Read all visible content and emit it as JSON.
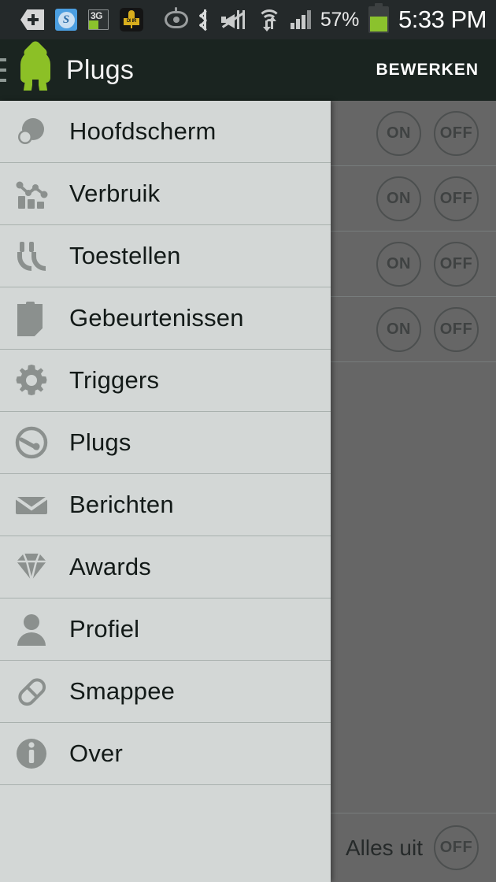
{
  "status_bar": {
    "background": "#24292a",
    "left_icons": [
      {
        "name": "add-tag-icon",
        "label": "add"
      },
      {
        "name": "skype-icon",
        "label": "S"
      },
      {
        "name": "network-3g-icon",
        "label": "3G"
      },
      {
        "name": "dnr-recorder-icon",
        "label": "DNR"
      }
    ],
    "right_icons": [
      {
        "name": "smart-stay-eye-icon",
        "label": "smart-stay"
      },
      {
        "name": "bluetooth-icon",
        "label": "bluetooth"
      },
      {
        "name": "sound-mute-vibrate-icon",
        "label": "mute"
      },
      {
        "name": "wifi-icon",
        "label": "wifi"
      },
      {
        "name": "cellular-signal-icon",
        "label": "signal"
      }
    ],
    "battery_percent": "57%",
    "battery_color": "#8bc22d",
    "time": "5:33 PM"
  },
  "app_bar": {
    "background": "#1a2420",
    "menu_icon": "hamburger-menu-icon",
    "logo_icon": "smappee-logo-icon",
    "logo_color": "#8cc026",
    "title": "Plugs",
    "action_label": "BEWERKEN"
  },
  "drawer": {
    "background": "#d3d7d6",
    "items": [
      {
        "label": "Hoofdscherm",
        "icon": "dashboard-icon"
      },
      {
        "label": "Verbruik",
        "icon": "consumption-chart-icon"
      },
      {
        "label": "Toestellen",
        "icon": "appliances-plug-icon"
      },
      {
        "label": "Gebeurtenissen",
        "icon": "events-clipboard-icon"
      },
      {
        "label": "Triggers",
        "icon": "gear-icon"
      },
      {
        "label": "Plugs",
        "icon": "plugs-circle-icon"
      },
      {
        "label": "Berichten",
        "icon": "envelope-icon"
      },
      {
        "label": "Awards",
        "icon": "diamond-icon"
      },
      {
        "label": "Profiel",
        "icon": "person-icon"
      },
      {
        "label": "Smappee",
        "icon": "smappee-pill-icon"
      },
      {
        "label": "Over",
        "icon": "info-icon"
      }
    ]
  },
  "content": {
    "overlay_color": "#666666",
    "plug_rows": [
      {
        "on_label": "ON",
        "off_label": "OFF"
      },
      {
        "on_label": "ON",
        "off_label": "OFF"
      },
      {
        "on_label": "ON",
        "off_label": "OFF"
      },
      {
        "on_label": "ON",
        "off_label": "OFF"
      }
    ],
    "all_off": {
      "label": "Alles uit",
      "button_label": "OFF"
    }
  }
}
